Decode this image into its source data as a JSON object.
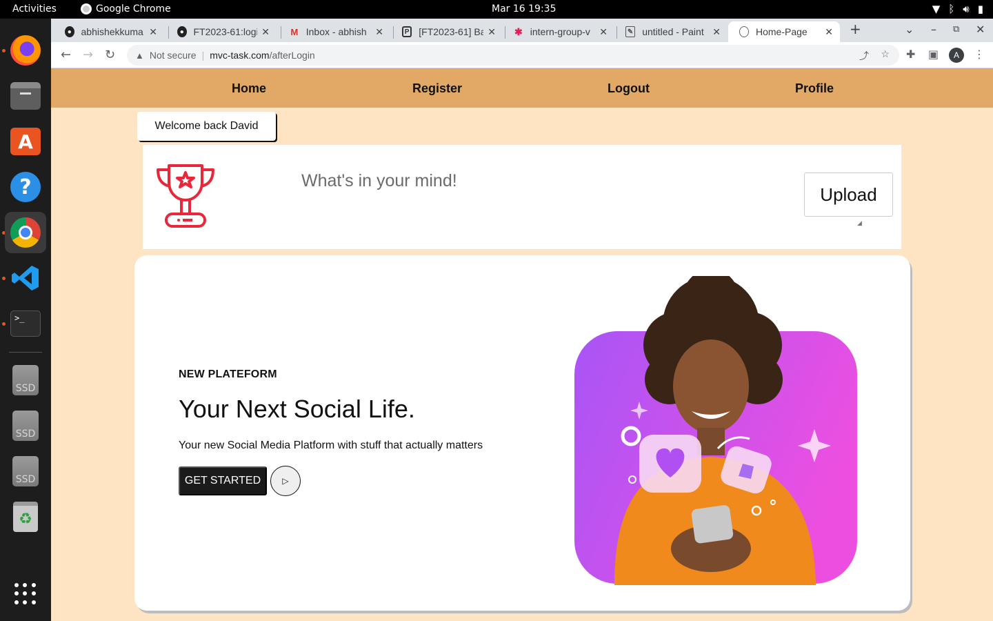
{
  "system": {
    "activities": "Activities",
    "app_name": "Google Chrome",
    "clock": "Mar 16  19:35",
    "tray_icons": [
      "wifi-icon",
      "bluetooth-icon",
      "volume-icon",
      "battery-icon"
    ]
  },
  "dock": {
    "items": [
      "firefox-icon",
      "files-icon",
      "app-store-icon",
      "help-icon",
      "chrome-icon",
      "vscode-icon",
      "terminal-icon",
      "ssd-drive-icon",
      "ssd-drive-icon",
      "ssd-drive-icon",
      "trash-icon",
      "app-grid-icon"
    ],
    "ssd_label": "SSD",
    "terminal_prompt": ">_"
  },
  "browser": {
    "tabs": [
      {
        "title": "abhishekkuma",
        "favicon": "github-icon"
      },
      {
        "title": "FT2023-61:logi",
        "favicon": "github-icon"
      },
      {
        "title": "Inbox - abhish",
        "favicon": "gmail-icon"
      },
      {
        "title": "[FT2023-61] Ba",
        "favicon": "jira-icon"
      },
      {
        "title": "intern-group-v",
        "favicon": "slack-icon"
      },
      {
        "title": "untitled - Paint",
        "favicon": "paint-icon"
      },
      {
        "title": "Home-Page",
        "favicon": "globe-icon"
      }
    ],
    "active_tab": 6,
    "security_label": "Not secure",
    "url_host": "mvc-task.com",
    "url_path": "/afterLogin",
    "profile_initial": "A"
  },
  "page": {
    "nav": {
      "home": "Home",
      "register": "Register",
      "logout": "Logout",
      "profile": "Profile"
    },
    "welcome": "Welcome back David",
    "post": {
      "placeholder": "What's in your mind!",
      "upload_label": "Upload"
    },
    "hero": {
      "kicker": "NEW PLATEFORM",
      "headline": "Your Next Social Life.",
      "subtext": "Your new Social Media Platform with stuff that actually matters",
      "cta_label": "GET STARTED",
      "play_icon": "play-icon"
    },
    "colors": {
      "navbar": "#e2a866",
      "page_bg": "#ffe4c4",
      "trophy": "#e8283a",
      "hero_gradient_start": "#a855f7",
      "hero_gradient_end": "#ec4fe0"
    }
  }
}
